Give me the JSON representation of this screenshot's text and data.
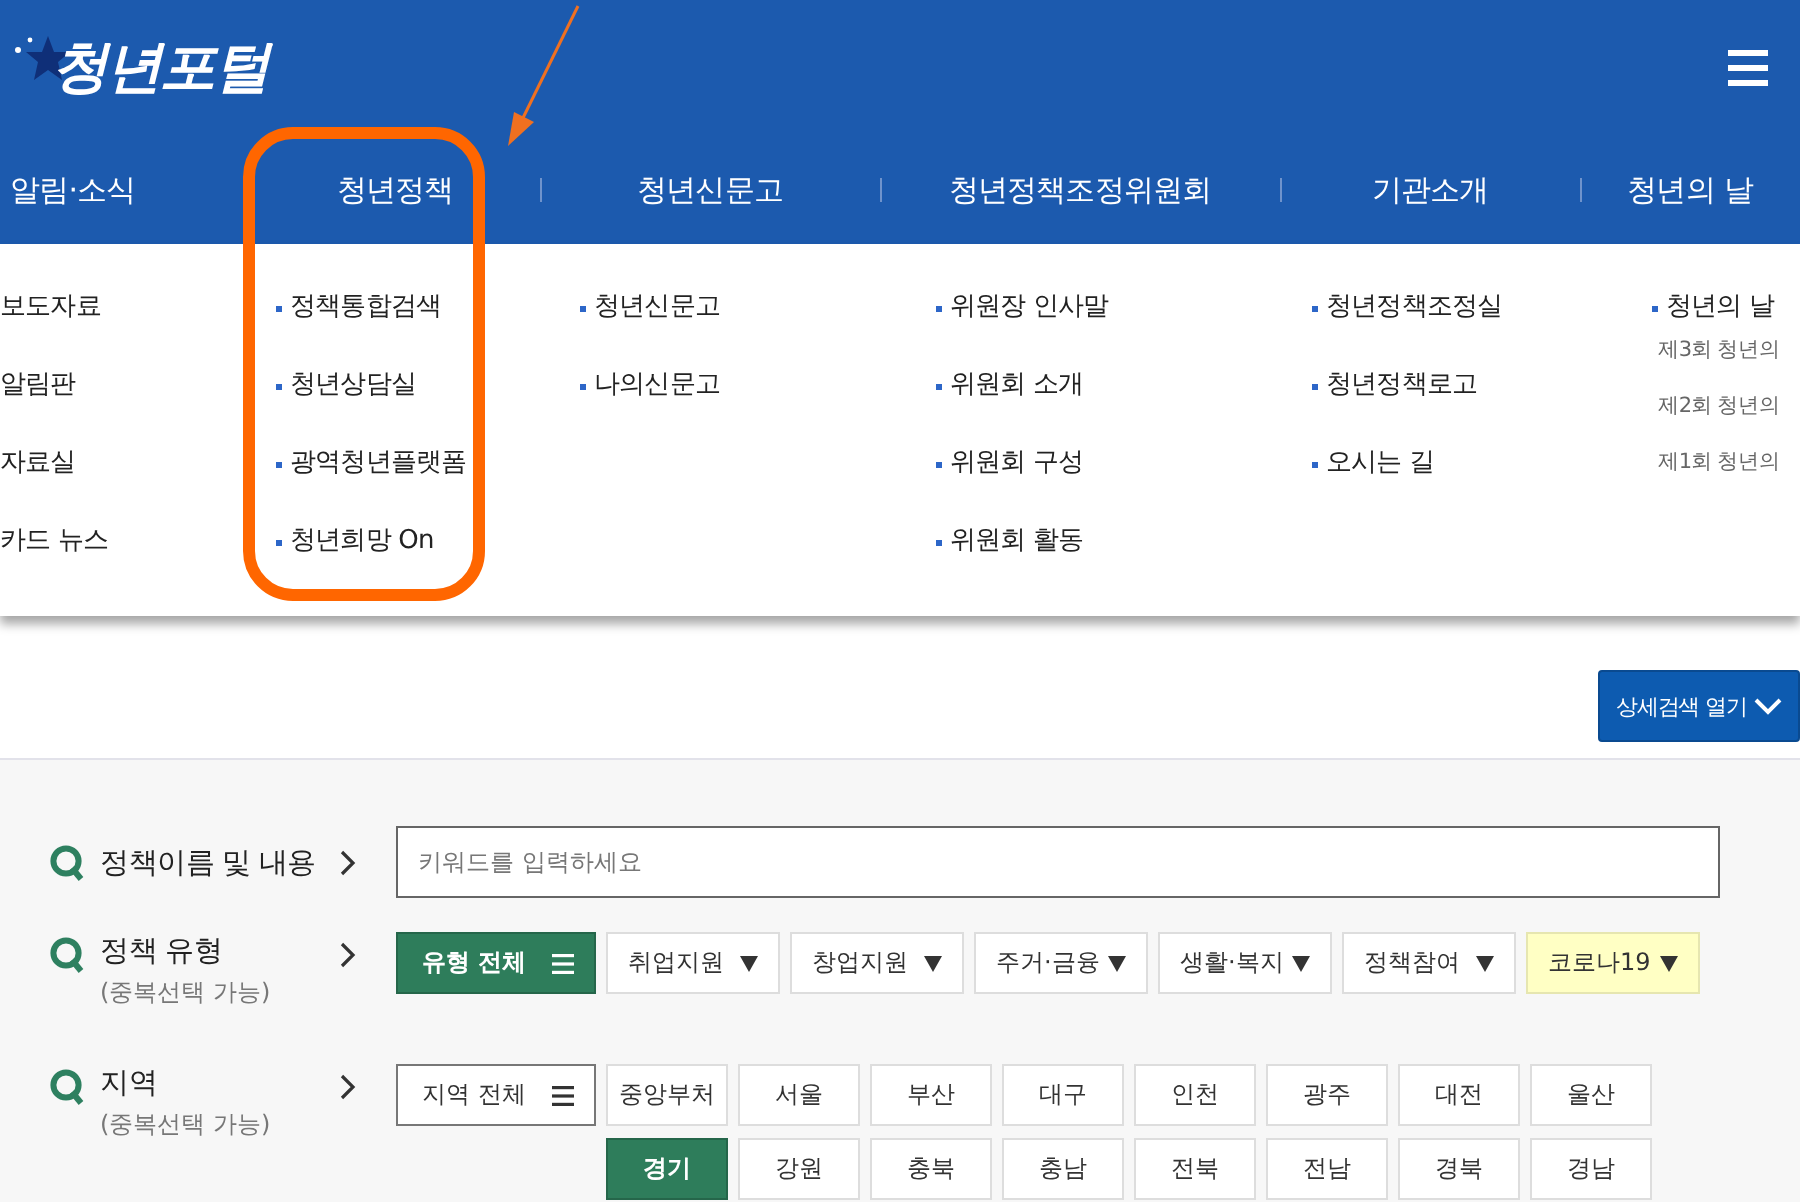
{
  "header": {
    "logo": "청년포털"
  },
  "nav": [
    {
      "label": "알림·소식"
    },
    {
      "label": "청년정책"
    },
    {
      "label": "청년신문고"
    },
    {
      "label": "청년정책조정위원회"
    },
    {
      "label": "기관소개"
    },
    {
      "label": "청년의 날"
    }
  ],
  "menu_columns": [
    {
      "bulleted": false,
      "items": [
        {
          "label": "보도자료"
        },
        {
          "label": "알림판"
        },
        {
          "label": "자료실"
        },
        {
          "label": "카드 뉴스"
        }
      ]
    },
    {
      "bulleted": true,
      "items": [
        {
          "label": "정책통합검색"
        },
        {
          "label": "청년상담실"
        },
        {
          "label": "광역청년플랫폼"
        },
        {
          "label": "청년희망 On"
        }
      ]
    },
    {
      "bulleted": true,
      "items": [
        {
          "label": "청년신문고"
        },
        {
          "label": "나의신문고"
        }
      ]
    },
    {
      "bulleted": true,
      "items": [
        {
          "label": "위원장 인사말"
        },
        {
          "label": "위원회 소개"
        },
        {
          "label": "위원회 구성"
        },
        {
          "label": "위원회 활동"
        }
      ]
    },
    {
      "bulleted": true,
      "items": [
        {
          "label": "청년정책조정실"
        },
        {
          "label": "청년정책로고"
        },
        {
          "label": "오시는 길"
        }
      ]
    },
    {
      "bulleted": true,
      "items": [
        {
          "label": "청년의 날",
          "children": [
            {
              "label": "제3회 청년의"
            },
            {
              "label": "제2회 청년의"
            },
            {
              "label": "제1회 청년의"
            }
          ]
        }
      ]
    }
  ],
  "detail_button": "상세검색 열기",
  "keyword_search": {
    "label": "정책이름 및 내용",
    "placeholder": "키워드를 입력하세요"
  },
  "type_filter": {
    "label": "정책 유형",
    "note": "(중복선택 가능)",
    "options": [
      {
        "label": "유형 전체",
        "kind": "all",
        "selected": true,
        "highlighted": false
      },
      {
        "label": "취업지원",
        "kind": "dropdown",
        "selected": false,
        "highlighted": false
      },
      {
        "label": "창업지원",
        "kind": "dropdown",
        "selected": false,
        "highlighted": false
      },
      {
        "label": "주거·금융",
        "kind": "dropdown",
        "selected": false,
        "highlighted": false
      },
      {
        "label": "생활·복지",
        "kind": "dropdown",
        "selected": false,
        "highlighted": false
      },
      {
        "label": "정책참여",
        "kind": "dropdown",
        "selected": false,
        "highlighted": false
      },
      {
        "label": "코로나19",
        "kind": "dropdown",
        "selected": false,
        "highlighted": true
      }
    ]
  },
  "region_filter": {
    "label": "지역",
    "note": "(중복선택 가능)",
    "all": {
      "label": "지역 전체",
      "selected": false
    },
    "options": [
      {
        "label": "중앙부처",
        "selected": false
      },
      {
        "label": "서울",
        "selected": false
      },
      {
        "label": "부산",
        "selected": false
      },
      {
        "label": "대구",
        "selected": false
      },
      {
        "label": "인천",
        "selected": false
      },
      {
        "label": "광주",
        "selected": false
      },
      {
        "label": "대전",
        "selected": false
      },
      {
        "label": "울산",
        "selected": false
      },
      {
        "label": "경기",
        "selected": true
      },
      {
        "label": "강원",
        "selected": false
      },
      {
        "label": "충북",
        "selected": false
      },
      {
        "label": "충남",
        "selected": false
      },
      {
        "label": "전북",
        "selected": false
      },
      {
        "label": "전남",
        "selected": false
      },
      {
        "label": "경북",
        "selected": false
      },
      {
        "label": "경남",
        "selected": false
      }
    ]
  }
}
